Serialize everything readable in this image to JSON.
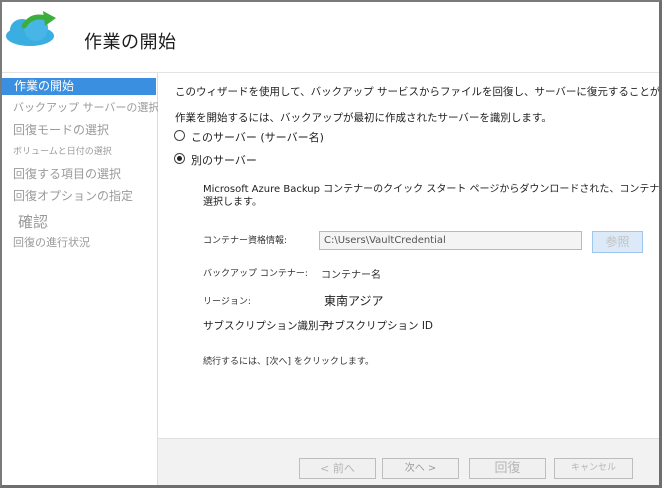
{
  "header": {
    "title": "作業の開始"
  },
  "sidebar": {
    "items": [
      {
        "label": "作業の開始",
        "active": true
      },
      {
        "label": "バックアップ サーバーの選択"
      },
      {
        "label": "回復モードの選択"
      },
      {
        "label": "ボリュームと日付の選択"
      },
      {
        "label": "回復する項目の選択"
      },
      {
        "label": "回復オプションの指定"
      },
      {
        "label": "確認"
      },
      {
        "label": "回復の進行状況"
      }
    ]
  },
  "main": {
    "intro": "このウィザードを使用して、バックアップ サービスからファイルを回復し、サーバーに復元することができます。",
    "identify": "作業を開始するには、バックアップが最初に作成されたサーバーを識別します。",
    "radio_this": "このサーバー (サーバー名)",
    "radio_other": "別のサーバー",
    "desc_line1": "Microsoft Azure Backup コンテナーのクイック スタート ページからダウンロードされた、コンテナー資格",
    "desc_line2": "選択します。",
    "cred_label": "コンテナー資格情報:",
    "cred_value": "C:\\Users\\VaultCredential",
    "browse_label": "参照",
    "vault_label": "バックアップ コンテナー:",
    "vault_value": "コンテナー名",
    "region_label": "リージョン:",
    "region_value": "東南アジア",
    "sub_label": "サブスクリプション識別子:",
    "sub_value": "サブスクリプション ID",
    "continue_text": "続行するには、[次へ] をクリックします。"
  },
  "footer": {
    "prev": "< 前へ",
    "next": "次へ >",
    "recover": "回復",
    "cancel": "キャンセル"
  },
  "colors": {
    "accent": "#3a8fe0",
    "logo_cloud": "#3aaee0",
    "logo_arrow": "#3cae3c"
  }
}
